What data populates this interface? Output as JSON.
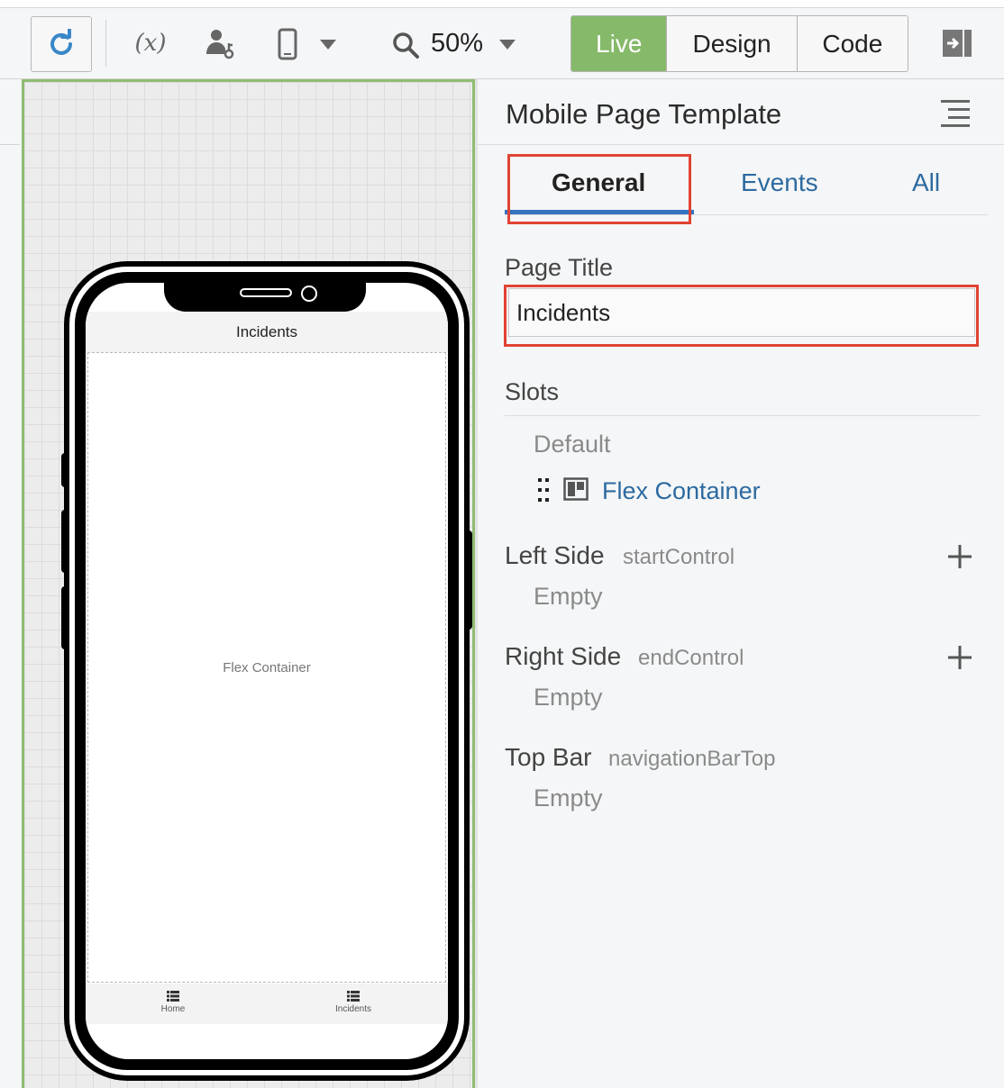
{
  "toolbar": {
    "zoom_value": "50%",
    "variable_symbol": "(x)",
    "modes": [
      {
        "label": "Live",
        "active": true
      },
      {
        "label": "Design",
        "active": false
      },
      {
        "label": "Code",
        "active": false
      }
    ],
    "icons": {
      "refresh": "refresh-icon",
      "variables": "variables-icon",
      "user": "user-role-icon",
      "device": "mobile-device-icon",
      "zoom": "magnifier-icon",
      "panel": "collapse-panel-icon"
    }
  },
  "canvas": {
    "phone": {
      "header_title": "Incidents",
      "container_label": "Flex Container",
      "tabs": [
        {
          "label": "Home"
        },
        {
          "label": "Incidents"
        }
      ]
    }
  },
  "panel": {
    "title": "Mobile Page Template",
    "tabs": [
      {
        "label": "General",
        "active": true
      },
      {
        "label": "Events",
        "active": false
      },
      {
        "label": "All",
        "active": false
      }
    ],
    "page_title": {
      "label": "Page Title",
      "value": "Incidents"
    },
    "slots": {
      "heading": "Slots",
      "default_label": "Default",
      "default_item": "Flex Container",
      "sections": [
        {
          "name": "Left Side",
          "hint": "startControl",
          "empty": "Empty"
        },
        {
          "name": "Right Side",
          "hint": "endControl",
          "empty": "Empty"
        },
        {
          "name": "Top Bar",
          "hint": "navigationBarTop",
          "empty": "Empty"
        }
      ]
    }
  },
  "colors": {
    "accent_blue": "#3573c1",
    "link_blue": "#2c6aa0",
    "live_green": "#86b96a",
    "highlight_red": "#e14333",
    "canvas_border": "#8fbd73"
  }
}
